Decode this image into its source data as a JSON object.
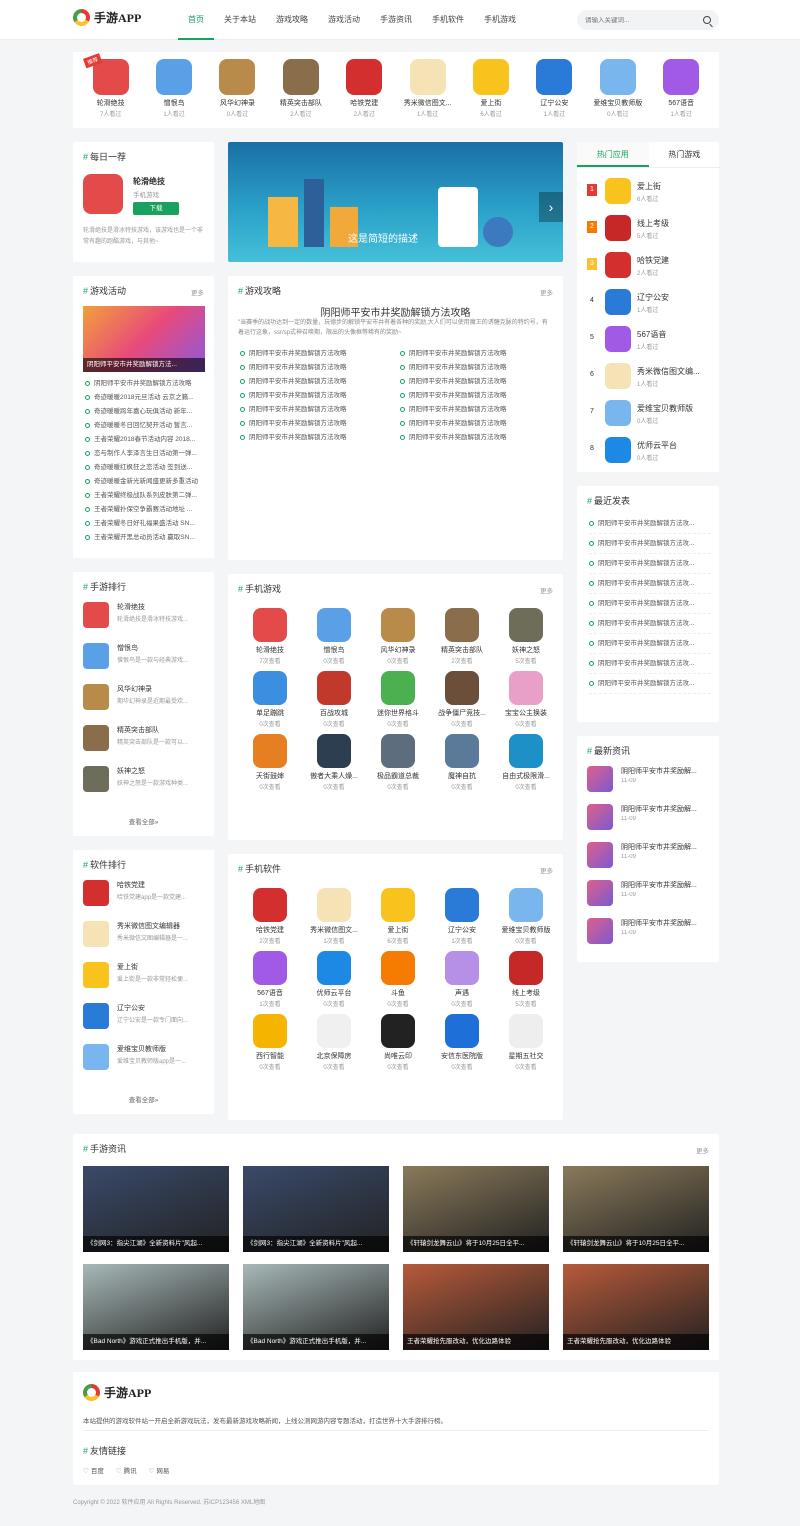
{
  "header": {
    "logo": "手游APP",
    "nav": [
      "首页",
      "关于本站",
      "游戏攻略",
      "游戏活动",
      "手游资讯",
      "手机软件",
      "手机游戏"
    ],
    "search_placeholder": "请输入关键词..."
  },
  "strip": {
    "badge": "推荐",
    "items": [
      {
        "name": "轮滑绝技",
        "views": "7人看过",
        "color": "#e34b4b"
      },
      {
        "name": "憎恨鸟",
        "views": "1人看过",
        "color": "#5aa0e6"
      },
      {
        "name": "风华幻神录",
        "views": "0人看过",
        "color": "#b98b4a"
      },
      {
        "name": "精英突击部队",
        "views": "2人看过",
        "color": "#8a6d4b"
      },
      {
        "name": "哈铁党建",
        "views": "2人看过",
        "color": "#d32f2f"
      },
      {
        "name": "秀米微信图文...",
        "views": "1人看过",
        "color": "#f5e3b5"
      },
      {
        "name": "爱上街",
        "views": "6人看过",
        "color": "#f7c31c"
      },
      {
        "name": "辽宁公安",
        "views": "1人看过",
        "color": "#2a7ad8"
      },
      {
        "name": "爱维宝贝教师版",
        "views": "0人看过",
        "color": "#7ab6ee"
      },
      {
        "name": "567语音",
        "views": "1人看过",
        "color": "#a05ae6"
      }
    ]
  },
  "daily": {
    "title": "每日一荐",
    "name": "轮滑绝技",
    "type": "手机游戏",
    "btn": "下载",
    "desc": "轮滑绝技是滑冰特技游戏，该游戏也是一个非常有趣的跑酷游戏，与其他~"
  },
  "banner": {
    "caption": "这是简短的描述"
  },
  "hot": {
    "tab1": "热门应用",
    "tab2": "热门游戏",
    "items": [
      {
        "n": "爱上街",
        "v": "6人看过",
        "c": "#f7c31c"
      },
      {
        "n": "线上考级",
        "v": "5人看过",
        "c": "#c62828"
      },
      {
        "n": "哈铁党建",
        "v": "2人看过",
        "c": "#d32f2f"
      },
      {
        "n": "辽宁公安",
        "v": "1人看过",
        "c": "#2a7ad8"
      },
      {
        "n": "567语音",
        "v": "1人看过",
        "c": "#a05ae6"
      },
      {
        "n": "秀米微信图文编...",
        "v": "1人看过",
        "c": "#f5e3b5"
      },
      {
        "n": "爱维宝贝教师版",
        "v": "0人看过",
        "c": "#7ab6ee"
      },
      {
        "n": "优师云平台",
        "v": "0人看过",
        "c": "#1e88e5"
      }
    ]
  },
  "activity": {
    "title": "游戏活动",
    "more": "更多",
    "img_cap": "阴阳师平安市井奖励解锁方法...",
    "items": [
      "阴阳师平安市井奖励解锁方法攻略",
      "奇迹暖暖2018元旦活动 云京之籁...",
      "奇迹暖暖跨年嘉心玩俱活动 新年...",
      "奇迹暖暖冬日回忆契开活动 暂言...",
      "王者荣耀2018春节活动内容 2018...",
      "恋与制作人李泽言生日活动第一弹...",
      "奇迹暖暖红枫狂之恋活动 签到送...",
      "奇迹暖暖金新光新闻盛更新多重活动",
      "王者荣耀终极战队系列皮肤第二弹...",
      "王者荣耀扑保空争霸赛活动地址 ...",
      "王者荣耀冬日好礼福果盛活动 SN...",
      "王者荣耀开黑总动员活动 赢取SN..."
    ]
  },
  "guide": {
    "title": "游戏攻略",
    "more": "更多",
    "headline": "阴阳师平安市井奖励解锁方法攻略",
    "summary": "\"当赛季的战功达到一定的数量，玩德步的解锁平安市井有着各种的奖励,大人们可以使用魔王的诱糖克脉的特约号，有着运行这象，ssr/sp式神召唤期，限出的头像框等稀有的奖励~",
    "items": [
      "阴阳师平安市井奖励解锁方法攻略",
      "阴阳师平安市井奖励解锁方法攻略",
      "阴阳师平安市井奖励解锁方法攻略",
      "阴阳师平安市井奖励解锁方法攻略",
      "阴阳师平安市井奖励解锁方法攻略",
      "阴阳师平安市井奖励解锁方法攻略",
      "阴阳师平安市井奖励解锁方法攻略",
      "阴阳师平安市井奖励解锁方法攻略",
      "阴阳师平安市井奖励解锁方法攻略",
      "阴阳师平安市井奖励解锁方法攻略",
      "阴阳师平安市井奖励解锁方法攻略",
      "阴阳师平安市井奖励解锁方法攻略",
      "阴阳师平安市井奖励解锁方法攻略",
      "阴阳师平安市井奖励解锁方法攻略"
    ]
  },
  "recent": {
    "title": "最近发表",
    "items": [
      "阴阳师平安市井奖励解锁方法攻...",
      "阴阳师平安市井奖励解锁方法攻...",
      "阴阳师平安市井奖励解锁方法攻...",
      "阴阳师平安市井奖励解锁方法攻...",
      "阴阳师平安市井奖励解锁方法攻...",
      "阴阳师平安市井奖励解锁方法攻...",
      "阴阳师平安市井奖励解锁方法攻...",
      "阴阳师平安市井奖励解锁方法攻...",
      "阴阳师平安市井奖励解锁方法攻..."
    ]
  },
  "latest": {
    "title": "最新资讯",
    "items": [
      {
        "t": "阴阳师平安市井奖励解...",
        "d": "11-09"
      },
      {
        "t": "阴阳师平安市井奖励解...",
        "d": "11-09"
      },
      {
        "t": "阴阳师平安市井奖励解...",
        "d": "11-09"
      },
      {
        "t": "阴阳师平安市井奖励解...",
        "d": "11-09"
      },
      {
        "t": "阴阳师平安市井奖励解...",
        "d": "11-09"
      }
    ]
  },
  "grank": {
    "title": "手游排行",
    "all": "查看全部»",
    "items": [
      {
        "n": "轮滑绝技",
        "s": "轮滑绝技是滑冰特技游戏...",
        "c": "#e34b4b"
      },
      {
        "n": "憎恨鸟",
        "s": "憎恨鸟是一款与经典游戏...",
        "c": "#5aa0e6"
      },
      {
        "n": "风华幻神录",
        "s": "期华幻神录是近期最受欢...",
        "c": "#b98b4a"
      },
      {
        "n": "精英突击部队",
        "s": "精英突击部队是一款可以...",
        "c": "#8a6d4b"
      },
      {
        "n": "妖神之怒",
        "s": "妖神之怒是一款游戏种类...",
        "c": "#6d6d5a"
      }
    ]
  },
  "srank": {
    "title": "软件排行",
    "all": "查看全部»",
    "items": [
      {
        "n": "哈铁党建",
        "s": "哈铁党建app是一款党建...",
        "c": "#d32f2f"
      },
      {
        "n": "秀米微信图文编辑器",
        "s": "秀米微信文图编辑器是一...",
        "c": "#f5e3b5"
      },
      {
        "n": "爱上街",
        "s": "爱上街是一款非常轻松便...",
        "c": "#f7c31c"
      },
      {
        "n": "辽宁公安",
        "s": "辽宁公安是一款专门面向...",
        "c": "#2a7ad8"
      },
      {
        "n": "爱维宝贝教师版",
        "s": "爱维宝贝教师版app是一...",
        "c": "#7ab6ee"
      }
    ]
  },
  "games": {
    "title": "手机游戏",
    "more": "更多",
    "items": [
      {
        "n": "轮滑绝技",
        "v": "7次查看",
        "c": "#e34b4b"
      },
      {
        "n": "憎恨鸟",
        "v": "0次查看",
        "c": "#5aa0e6"
      },
      {
        "n": "风华幻神录",
        "v": "0次查看",
        "c": "#b98b4a"
      },
      {
        "n": "精英突击部队",
        "v": "2次查看",
        "c": "#8a6d4b"
      },
      {
        "n": "妖神之怒",
        "v": "5次查看",
        "c": "#6d6d5a"
      },
      {
        "n": "单足蹦跳",
        "v": "0次查看",
        "c": "#3a8fe0"
      },
      {
        "n": "百战攻城",
        "v": "0次查看",
        "c": "#c0392b"
      },
      {
        "n": "迷你世界格斗",
        "v": "0次查看",
        "c": "#4caf50"
      },
      {
        "n": "战争僵尸竞技...",
        "v": "0次查看",
        "c": "#6b4f3a"
      },
      {
        "n": "宝宝公主换装",
        "v": "0次查看",
        "c": "#e8a0c8"
      },
      {
        "n": "天街鼓婶",
        "v": "0次查看",
        "c": "#e67e22"
      },
      {
        "n": "傲者大乘人燥...",
        "v": "0次查看",
        "c": "#2c3e50"
      },
      {
        "n": "极品霸道总裁",
        "v": "0次查看",
        "c": "#5d6d7e"
      },
      {
        "n": "魔神自抗",
        "v": "0次查看",
        "c": "#5b7a99"
      },
      {
        "n": "自由式极限滑...",
        "v": "0次查看",
        "c": "#1e90c8"
      }
    ]
  },
  "apps": {
    "title": "手机软件",
    "more": "更多",
    "items": [
      {
        "n": "哈铁党建",
        "v": "2次查看",
        "c": "#d32f2f"
      },
      {
        "n": "秀米微信图文...",
        "v": "1次查看",
        "c": "#f5e3b5"
      },
      {
        "n": "爱上街",
        "v": "6次查看",
        "c": "#f7c31c"
      },
      {
        "n": "辽宁公安",
        "v": "1次查看",
        "c": "#2a7ad8"
      },
      {
        "n": "爱维宝贝教师版",
        "v": "0次查看",
        "c": "#7ab6ee"
      },
      {
        "n": "567语音",
        "v": "1次查看",
        "c": "#a05ae6"
      },
      {
        "n": "优师云平台",
        "v": "0次查看",
        "c": "#1e88e5"
      },
      {
        "n": "斗鱼",
        "v": "0次查看",
        "c": "#f57c00"
      },
      {
        "n": "声遇",
        "v": "0次查看",
        "c": "#b68fe6"
      },
      {
        "n": "线上考级",
        "v": "5次查看",
        "c": "#c62828"
      },
      {
        "n": "西行智能",
        "v": "0次查看",
        "c": "#f5b400"
      },
      {
        "n": "北京保障房",
        "v": "0次查看",
        "c": "#f0f0f0"
      },
      {
        "n": "尚唯云印",
        "v": "0次查看",
        "c": "#222"
      },
      {
        "n": "安信东医院版",
        "v": "0次查看",
        "c": "#1e6fd8"
      },
      {
        "n": "星期五社交",
        "v": "0次查看",
        "c": "#eee"
      }
    ]
  },
  "news": {
    "title": "手游资讯",
    "more": "更多",
    "items": [
      {
        "t": "《剑网3：指尖江湖》全新资料片\"风起...",
        "c": "#3a4a6a"
      },
      {
        "t": "《剑网3：指尖江湖》全新资料片\"风起...",
        "c": "#3a4a6a"
      },
      {
        "t": "《轩辕剑龙舞云山》将于10月25日全平...",
        "c": "#8a7a5a"
      },
      {
        "t": "《轩辕剑龙舞云山》将于10月25日全平...",
        "c": "#8a7a5a"
      },
      {
        "t": "《Bad North》游戏正式推出手机版，并...",
        "c": "#a8b8b8"
      },
      {
        "t": "《Bad North》游戏正式推出手机版，并...",
        "c": "#a8b8b8"
      },
      {
        "t": "王者荣耀抢先服改动，优化边路体验",
        "c": "#b85a3a"
      },
      {
        "t": "王者荣耀抢先服改动，优化边路体验",
        "c": "#b85a3a"
      }
    ]
  },
  "footer": {
    "logo": "手游APP",
    "desc": "本站提供的游戏软件站一开启全新游戏玩法，发布最新游戏攻略新闻，上线公测网游内容专题活动，打造世界十大手游排行榜。",
    "links_title": "友情链接",
    "links": [
      "百度",
      "腾讯",
      "网易"
    ],
    "copyright": "Copyright © 2022 软件应用 All Rights Reserved. 苏ICP123456 XML地图"
  }
}
